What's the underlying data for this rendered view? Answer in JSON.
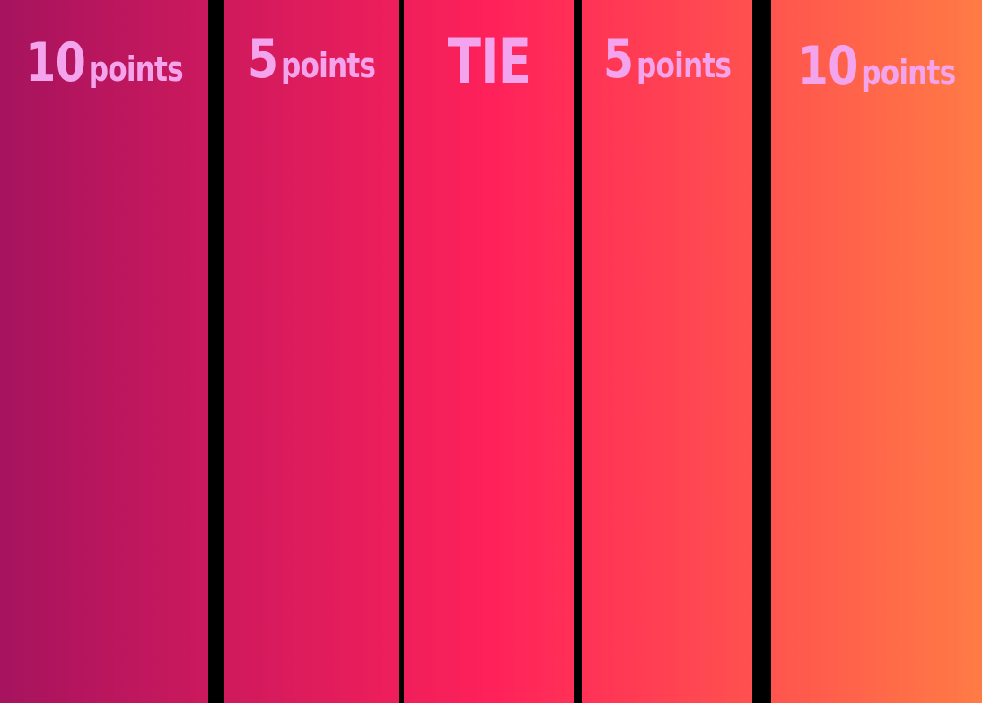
{
  "colors": {
    "gradient_start": "#a6135f",
    "gradient_middle": "#ff215a",
    "gradient_end": "#ff7b45",
    "label_text": "#f4a4ec",
    "divider": "#000000"
  },
  "zones": [
    {
      "value": "10",
      "unit": "points"
    },
    {
      "value": "5",
      "unit": "points"
    },
    {
      "value": "TIE",
      "unit": ""
    },
    {
      "value": "5",
      "unit": "points"
    },
    {
      "value": "10",
      "unit": "points"
    }
  ]
}
